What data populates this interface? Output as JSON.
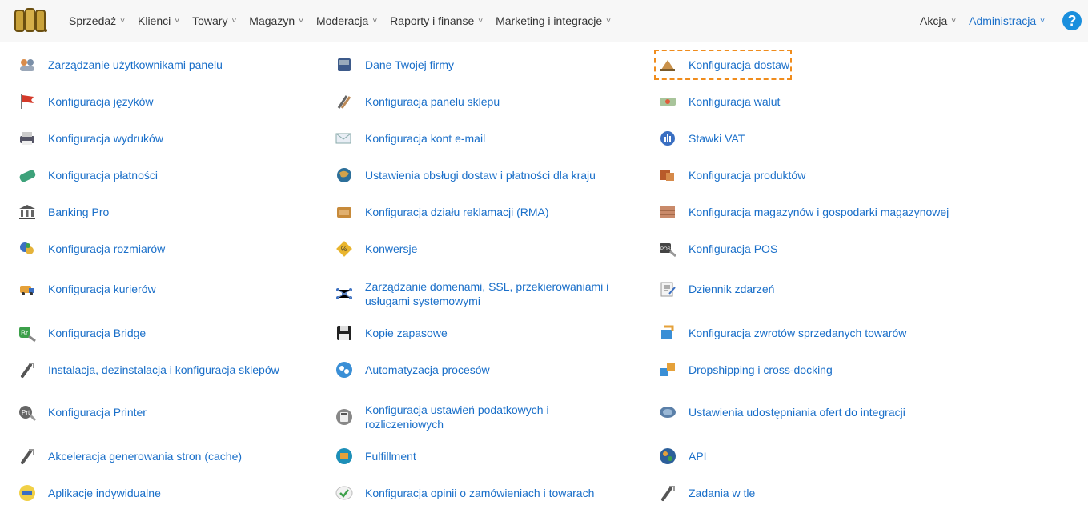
{
  "nav": {
    "left": [
      {
        "label": "Sprzedaż"
      },
      {
        "label": "Klienci"
      },
      {
        "label": "Towary"
      },
      {
        "label": "Magazyn"
      },
      {
        "label": "Moderacja"
      },
      {
        "label": "Raporty i finanse"
      },
      {
        "label": "Marketing i integracje"
      }
    ],
    "right": [
      {
        "label": "Akcja"
      },
      {
        "label": "Administracja"
      }
    ],
    "chevron": "˅",
    "help": "?"
  },
  "columns": [
    [
      {
        "label": "Zarządzanie użytkownikami panelu",
        "icon": "users-icon"
      },
      {
        "label": "Konfiguracja języków",
        "icon": "flag-icon"
      },
      {
        "label": "Konfiguracja wydruków",
        "icon": "printer-icon"
      },
      {
        "label": "Konfiguracja płatności",
        "icon": "card-icon"
      },
      {
        "label": "Banking Pro",
        "icon": "bank-icon"
      },
      {
        "label": "Konfiguracja rozmiarów",
        "icon": "shapes-icon"
      },
      {
        "label": "Konfiguracja kurierów",
        "icon": "courier-icon"
      },
      {
        "label": "Konfiguracja Bridge",
        "icon": "bridge-icon"
      },
      {
        "label": "Instalacja, dezinstalacja i konfiguracja sklepów",
        "icon": "tool-icon"
      },
      {
        "label": "Konfiguracja Printer",
        "icon": "prt-icon"
      },
      {
        "label": "Akceleracja generowania stron (cache)",
        "icon": "tool-icon"
      },
      {
        "label": "Aplikacje indywidualne",
        "icon": "app-icon"
      }
    ],
    [
      {
        "label": "Dane Twojej firmy",
        "icon": "company-icon"
      },
      {
        "label": "Konfiguracja panelu sklepu",
        "icon": "tools-icon"
      },
      {
        "label": "Konfiguracja kont e-mail",
        "icon": "email-icon"
      },
      {
        "label": "Ustawienia obsługi dostaw i płatności dla kraju",
        "icon": "globe-icon"
      },
      {
        "label": "Konfiguracja działu reklamacji (RMA)",
        "icon": "rma-icon"
      },
      {
        "label": "Konwersje",
        "icon": "conversion-icon"
      },
      {
        "label": "Zarządzanie domenami, SSL, przekierowaniami i usługami systemowymi",
        "icon": "network-icon"
      },
      {
        "label": "Kopie zapasowe",
        "icon": "floppy-icon"
      },
      {
        "label": "Automatyzacja procesów",
        "icon": "gears-icon"
      },
      {
        "label": "Konfiguracja ustawień podatkowych i rozliczeniowych",
        "icon": "calculator-icon"
      },
      {
        "label": "Fulfillment",
        "icon": "fulfillment-icon"
      },
      {
        "label": "Konfiguracja opinii o zamówieniach i towarach",
        "icon": "check-bubble-icon"
      }
    ],
    [
      {
        "label": "Konfiguracja dostaw",
        "icon": "delivery-icon"
      },
      {
        "label": "Konfiguracja walut",
        "icon": "money-icon"
      },
      {
        "label": "Stawki VAT",
        "icon": "vat-icon"
      },
      {
        "label": "Konfiguracja produktów",
        "icon": "products-icon"
      },
      {
        "label": "Konfiguracja magazynów i gospodarki magazynowej",
        "icon": "warehouse-icon"
      },
      {
        "label": "Konfiguracja POS",
        "icon": "pos-icon"
      },
      {
        "label": "Dziennik zdarzeń",
        "icon": "log-icon"
      },
      {
        "label": "Konfiguracja zwrotów sprzedanych towarów",
        "icon": "returns-icon"
      },
      {
        "label": "Dropshipping i cross-docking",
        "icon": "dropshipping-icon"
      },
      {
        "label": "Ustawienia udostępniania ofert do integracji",
        "icon": "share-icon"
      },
      {
        "label": "API",
        "icon": "api-icon"
      },
      {
        "label": "Zadania w tle",
        "icon": "tool-icon"
      }
    ]
  ],
  "highlighted_item": "Konfiguracja dostaw",
  "colors": {
    "link": "#1a6fc9",
    "highlight": "#f08c1c",
    "help": "#1a8fdd"
  }
}
